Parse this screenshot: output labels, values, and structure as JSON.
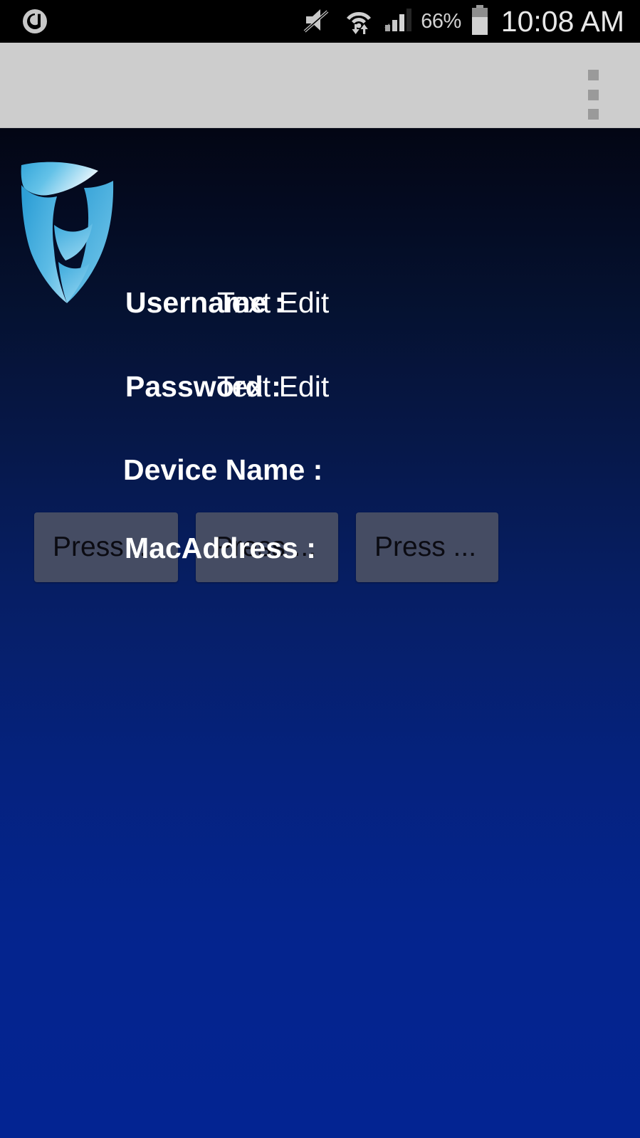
{
  "statusbar": {
    "app_icon": "circle-a-notification-icon",
    "mute_icon": "volume-muted-icon",
    "wifi_icon": "wifi-transfer-icon",
    "signal_icon": "cellular-signal-icon",
    "battery_percent": "66%",
    "battery_icon": "battery-icon",
    "clock": "10:08 AM"
  },
  "actionbar": {
    "title": "",
    "overflow_icon": "overflow-menu-icon"
  },
  "content": {
    "logo_icon": "shield-logo-icon",
    "fields": [
      {
        "label": "Username :",
        "value": "Text Edit"
      },
      {
        "label": "Password :",
        "value": "Text Edit"
      },
      {
        "label": "Device Name :",
        "value": ""
      },
      {
        "label": "MacAddress :",
        "value": ""
      }
    ],
    "buttons": [
      {
        "label": "Press ..."
      },
      {
        "label": "Press ..."
      },
      {
        "label": "Press ..."
      }
    ]
  },
  "colors": {
    "statusbar_bg": "#000000",
    "actionbar_bg": "#cdcdcd",
    "gradient_top": "#030614",
    "gradient_bottom": "#032492",
    "button_bg": "#454c63",
    "logo_blue_light": "#bfe3f5",
    "logo_blue_mid": "#5bb8e0",
    "logo_blue_dark": "#2a9ed4",
    "text_primary": "#ffffff"
  }
}
